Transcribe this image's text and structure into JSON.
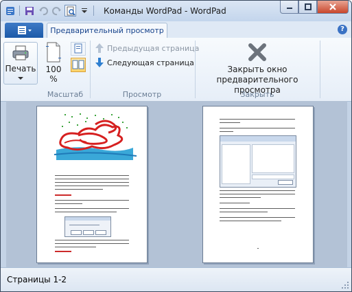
{
  "window": {
    "title": "Команды WordPad - WordPad"
  },
  "ribbon": {
    "tab_label": "Предварительный просмотр",
    "print": {
      "label": "Печать"
    },
    "zoom": {
      "value": "100\n%",
      "value_line1": "100",
      "value_line2": "%",
      "group_label": "Масштаб"
    },
    "view": {
      "prev_page_label": "Предыдущая страница",
      "next_page_label": "Следующая страница",
      "group_label": "Просмотр"
    },
    "close": {
      "label_line1": "Закрыть окно",
      "label_line2": "предварительного просмотра",
      "group_label": "Закрыть"
    }
  },
  "status": {
    "pages_text": "Страницы 1-2"
  },
  "colors": {
    "accent": "#1c5aa8",
    "ribbon_bg": "#e6eef8",
    "preview_bg": "#b3c2d6"
  },
  "icons": [
    "save-icon",
    "undo-icon",
    "redo-icon",
    "print-preview-icon",
    "printer-icon",
    "page-icon",
    "one-page-icon",
    "two-page-icon",
    "arrow-up-icon",
    "arrow-down-icon",
    "close-x-icon",
    "help-icon"
  ]
}
